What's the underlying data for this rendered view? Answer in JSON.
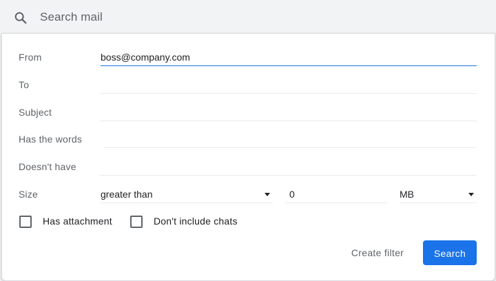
{
  "search": {
    "placeholder": "Search mail"
  },
  "form": {
    "from": {
      "label": "From",
      "value": "boss@company.com"
    },
    "to": {
      "label": "To",
      "value": ""
    },
    "subject": {
      "label": "Subject",
      "value": ""
    },
    "has_words": {
      "label": "Has the words",
      "value": ""
    },
    "doesnt_have": {
      "label": "Doesn't have",
      "value": ""
    },
    "size": {
      "label": "Size",
      "comparator": "greater than",
      "amount": "0",
      "unit": "MB"
    },
    "has_attachment": {
      "label": "Has attachment",
      "checked": false
    },
    "dont_include_chats": {
      "label": "Don't include chats",
      "checked": false
    }
  },
  "actions": {
    "create_filter": "Create filter",
    "search": "Search"
  },
  "colors": {
    "accent": "#1a73e8",
    "label": "#5f6368",
    "text": "#202124",
    "divider": "#e8eaed"
  }
}
